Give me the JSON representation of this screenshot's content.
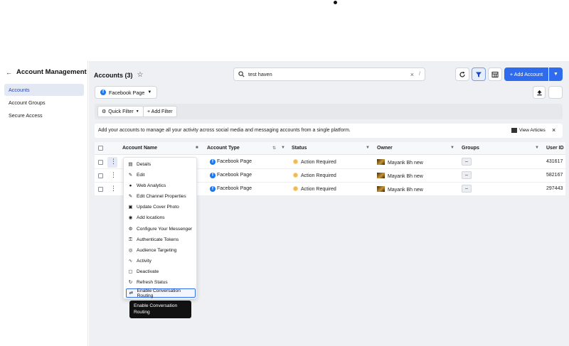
{
  "sidebar": {
    "title": "Account Management",
    "items": [
      {
        "label": "Accounts",
        "active": true
      },
      {
        "label": "Account Groups",
        "active": false
      },
      {
        "label": "Secure Access",
        "active": false
      }
    ]
  },
  "header": {
    "title": "Accounts (3)",
    "search_value": "test haven",
    "search_shortcut": "/",
    "add_account_label": "+ Add Account"
  },
  "chip": {
    "label": "Facebook Page"
  },
  "filters": {
    "quick_filter": "Quick Filter",
    "add_filter": "+ Add Filter"
  },
  "info": {
    "text": "Add your accounts to manage all your activity across social media and messaging accounts from a single platform.",
    "view_articles": "View Articles"
  },
  "table": {
    "columns": [
      "Account Name",
      "Account Type",
      "Status",
      "Owner",
      "Groups",
      "User ID"
    ],
    "rows": [
      {
        "type": "Facebook Page",
        "status": "Action Required",
        "owner": "Mayank Bh new",
        "groups": "–",
        "user_id": "431617"
      },
      {
        "type": "Facebook Page",
        "status": "Action Required",
        "owner": "Mayank Bh new",
        "groups": "–",
        "user_id": "582167"
      },
      {
        "type": "Facebook Page",
        "status": "Action Required",
        "owner": "Mayank Bh new",
        "groups": "–",
        "user_id": "297443"
      }
    ]
  },
  "menu": {
    "items": [
      {
        "label": "Details",
        "icon": "details-icon"
      },
      {
        "label": "Edit",
        "icon": "pencil-icon"
      },
      {
        "label": "Web Analytics",
        "icon": "globe-icon"
      },
      {
        "label": "Edit Channel Properties",
        "icon": "pencil-icon"
      },
      {
        "label": "Update Cover Photo",
        "icon": "image-icon"
      },
      {
        "label": "Add locations",
        "icon": "location-icon"
      },
      {
        "label": "Configure Your Messenger",
        "icon": "gear-icon"
      },
      {
        "label": "Authenticate Tokens",
        "icon": "key-icon"
      },
      {
        "label": "Audience Targeting",
        "icon": "target-icon"
      },
      {
        "label": "Activity",
        "icon": "activity-icon"
      },
      {
        "label": "Deactivate",
        "icon": "deactivate-icon"
      },
      {
        "label": "Refresh Status",
        "icon": "refresh-icon"
      },
      {
        "label": "Enable Conversation Routing",
        "icon": "routing-icon"
      }
    ]
  },
  "tooltip": {
    "text": "Enable Conversation Routing"
  },
  "colors": {
    "accent": "#2f6bed",
    "sidebar_active_bg": "#e3e8f3",
    "status_warning": "#f2b84a"
  }
}
